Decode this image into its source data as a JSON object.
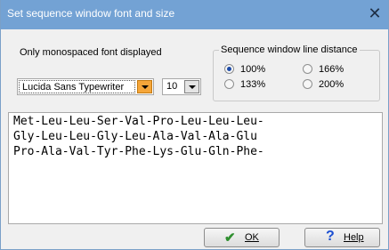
{
  "window": {
    "title": "Set sequence window font and size"
  },
  "font": {
    "label": "Only monospaced font displayed",
    "selected_font": "Lucida Sans Typewriter",
    "selected_size": "10"
  },
  "line_distance": {
    "legend": "Sequence window line distance",
    "options": [
      {
        "label": "100%",
        "checked": true
      },
      {
        "label": "166%",
        "checked": false
      },
      {
        "label": "133%",
        "checked": false
      },
      {
        "label": "200%",
        "checked": false
      }
    ]
  },
  "sequence": {
    "lines": [
      "Met-Leu-Leu-Ser-Val-Pro-Leu-Leu-Leu-",
      "Gly-Leu-Leu-Gly-Leu-Ala-Val-Ala-Glu",
      "Pro-Ala-Val-Tyr-Phe-Lys-Glu-Gln-Phe-"
    ]
  },
  "buttons": {
    "ok_label": "OK",
    "help_label": "Help"
  },
  "icons": {
    "close": "close-icon",
    "font_dropdown": "chevron-down-icon",
    "size_dropdown": "chevron-down-icon",
    "ok": "checkmark-icon",
    "help": "question-mark-icon"
  },
  "colors": {
    "titlebar": "#73a2d4",
    "ok_check": "#2f8f2f",
    "help_question": "#1b4ed1",
    "dropdown_accent": "#f5a63a"
  }
}
